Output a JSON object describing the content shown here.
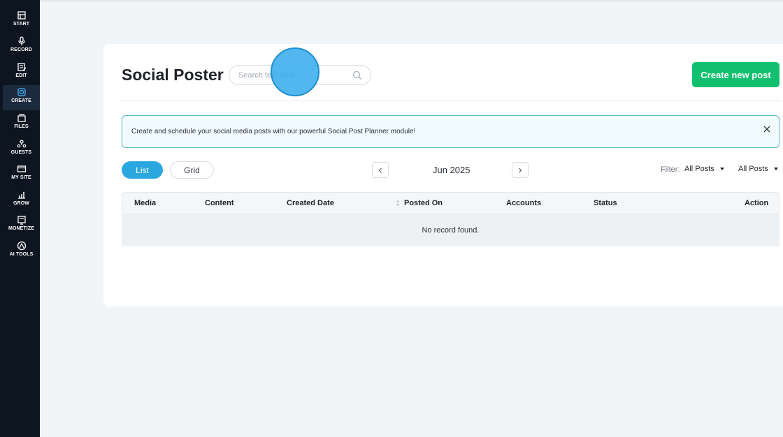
{
  "sidebar": {
    "items": [
      {
        "label": "START",
        "icon": "start-icon"
      },
      {
        "label": "RECORD",
        "icon": "microphone-icon"
      },
      {
        "label": "EDIT",
        "icon": "edit-icon"
      },
      {
        "label": "CREATE",
        "icon": "create-icon",
        "active": true
      },
      {
        "label": "FILES",
        "icon": "files-icon"
      },
      {
        "label": "GUESTS",
        "icon": "guests-icon"
      },
      {
        "label": "MY SITE",
        "icon": "site-icon"
      },
      {
        "label": "GROW",
        "icon": "chart-icon"
      },
      {
        "label": "MONETIZE",
        "icon": "monetize-icon"
      },
      {
        "label": "AI TOOLS",
        "icon": "ai-icon"
      }
    ]
  },
  "header": {
    "title": "Social Poster",
    "search_placeholder": "Search text here...",
    "create_button": "Create new post"
  },
  "banner": {
    "text": "Create and schedule your social media posts with our powerful Social Post Planner module!"
  },
  "view_toggle": {
    "list": "List",
    "grid": "Grid",
    "active": "List"
  },
  "month_nav": {
    "label": "Jun 2025"
  },
  "filters": {
    "label": "Filter:",
    "first_value": "All Posts",
    "second_value": "All Posts"
  },
  "table": {
    "columns": [
      "Media",
      "Content",
      "Created Date",
      "Posted On",
      "Accounts",
      "Status",
      "Action"
    ],
    "empty_message": "No record found."
  },
  "colors": {
    "sidebar_bg": "#0d1520",
    "primary_blue": "#2aa7df",
    "create_green": "#11c06e",
    "banner_border": "#56b7c5"
  }
}
